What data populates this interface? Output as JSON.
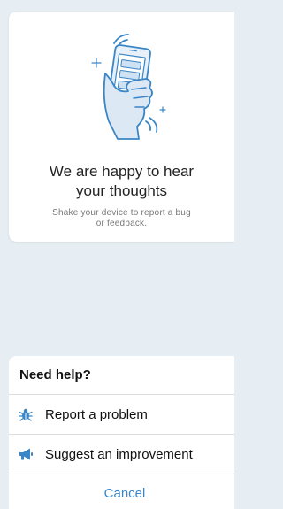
{
  "card": {
    "title_line1": "We are happy to hear",
    "title_line2": "your thoughts",
    "subtitle_line1": "Shake your device to report a bug",
    "subtitle_line2": "or feedback.",
    "illustration_icon": "shake-phone-icon"
  },
  "sheet": {
    "title": "Need help?",
    "items": [
      {
        "label": "Report a problem",
        "icon": "bug-icon"
      },
      {
        "label": "Suggest an improvement",
        "icon": "megaphone-icon"
      }
    ],
    "cancel_label": "Cancel"
  },
  "colors": {
    "accent": "#3a86c6",
    "background": "#e6eef3",
    "card": "#ffffff"
  }
}
